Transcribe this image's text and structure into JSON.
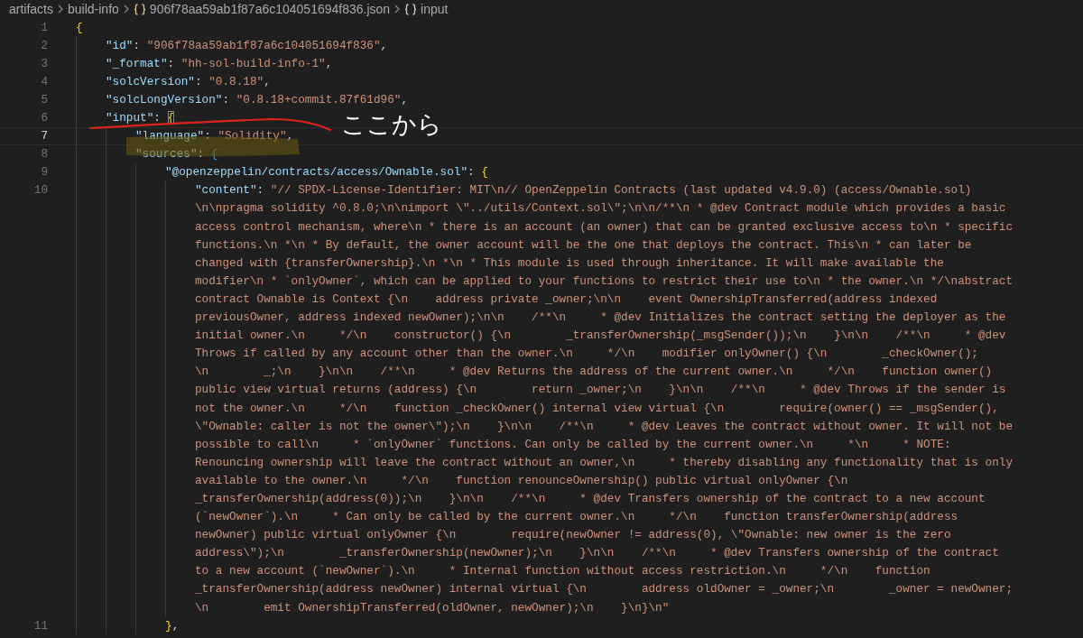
{
  "breadcrumb": [
    {
      "label": "artifacts",
      "kind": "folder"
    },
    {
      "label": "build-info",
      "kind": "folder"
    },
    {
      "label": "906f78aa59ab1f87a6c104051694f836.json",
      "kind": "json"
    },
    {
      "label": "input",
      "kind": "object"
    }
  ],
  "lines": [
    {
      "number": "1",
      "current": false,
      "tokens": [
        {
          "kind": "brace",
          "text": "{"
        }
      ],
      "children": [
        {
          "number": "2",
          "current": false,
          "tokens": [
            {
              "kind": "key",
              "text": "\"id\""
            },
            {
              "kind": "punct",
              "text": ": "
            },
            {
              "kind": "string",
              "text": "\"906f78aa59ab1f87a6c104051694f836\""
            },
            {
              "kind": "punct",
              "text": ","
            }
          ]
        },
        {
          "number": "3",
          "current": false,
          "tokens": [
            {
              "kind": "key",
              "text": "\"_format\""
            },
            {
              "kind": "punct",
              "text": ": "
            },
            {
              "kind": "string",
              "text": "\"hh-sol-build-info-1\""
            },
            {
              "kind": "punct",
              "text": ","
            }
          ]
        },
        {
          "number": "4",
          "current": false,
          "tokens": [
            {
              "kind": "key",
              "text": "\"solcVersion\""
            },
            {
              "kind": "punct",
              "text": ": "
            },
            {
              "kind": "string",
              "text": "\"0.8.18\""
            },
            {
              "kind": "punct",
              "text": ","
            }
          ]
        },
        {
          "number": "5",
          "current": false,
          "tokens": [
            {
              "kind": "key",
              "text": "\"solcLongVersion\""
            },
            {
              "kind": "punct",
              "text": ": "
            },
            {
              "kind": "string",
              "text": "\"0.8.18+commit.87f61d96\""
            },
            {
              "kind": "punct",
              "text": ","
            }
          ]
        },
        {
          "number": "6",
          "current": false,
          "tokens": [
            {
              "kind": "key",
              "text": "\"input\""
            },
            {
              "kind": "punct",
              "text": ": "
            },
            {
              "kind": "matched",
              "text": "{"
            }
          ],
          "children": [
            {
              "number": "7",
              "current": true,
              "tokens": [
                {
                  "kind": "key",
                  "text": "\"language\""
                },
                {
                  "kind": "punct",
                  "text": ": "
                },
                {
                  "kind": "string",
                  "text": "\"Solidity\""
                },
                {
                  "kind": "punct",
                  "text": ","
                }
              ]
            },
            {
              "number": "8",
              "current": false,
              "tokens": [
                {
                  "kind": "key",
                  "text": "\"sources\""
                },
                {
                  "kind": "punct",
                  "text": ": "
                },
                {
                  "kind": "innerbrace",
                  "text": "{"
                }
              ],
              "children": [
                {
                  "number": "9",
                  "current": false,
                  "tokens": [
                    {
                      "kind": "key",
                      "text": "\"@openzeppelin/contracts/access/Ownable.sol\""
                    },
                    {
                      "kind": "punct",
                      "text": ": "
                    },
                    {
                      "kind": "brace",
                      "text": "{"
                    }
                  ],
                  "children": [
                    {
                      "number": "10",
                      "current": false,
                      "tokens": [
                        {
                          "kind": "key",
                          "text": "\"content\""
                        },
                        {
                          "kind": "punct",
                          "text": ": "
                        },
                        {
                          "kind": "string",
                          "text": "\"// SPDX-License-Identifier: MIT\\n// OpenZeppelin Contracts (last updated v4.9.0) (access/Ownable.sol)"
                        }
                      ],
                      "wrap": [
                        "\\n\\npragma solidity ^0.8.0;\\n\\nimport \\\"../utils/Context.sol\\\";\\n\\n/**\\n * @dev Contract module which provides a basic",
                        "access control mechanism, where\\n * there is an account (an owner) that can be granted exclusive access to\\n * specific",
                        "functions.\\n *\\n * By default, the owner account will be the one that deploys the contract. This\\n * can later be",
                        "changed with {transferOwnership}.\\n *\\n * This module is used through inheritance. It will make available the",
                        "modifier\\n * `onlyOwner`, which can be applied to your functions to restrict their use to\\n * the owner.\\n */\\nabstract",
                        "contract Ownable is Context {\\n    address private _owner;\\n\\n    event OwnershipTransferred(address indexed",
                        "previousOwner, address indexed newOwner);\\n\\n    /**\\n     * @dev Initializes the contract setting the deployer as the",
                        "initial owner.\\n     */\\n    constructor() {\\n        _transferOwnership(_msgSender());\\n    }\\n\\n    /**\\n     * @dev",
                        "Throws if called by any account other than the owner.\\n     */\\n    modifier onlyOwner() {\\n        _checkOwner();",
                        "\\n        _;\\n    }\\n\\n    /**\\n     * @dev Returns the address of the current owner.\\n     */\\n    function owner()",
                        "public view virtual returns (address) {\\n        return _owner;\\n    }\\n\\n    /**\\n     * @dev Throws if the sender is",
                        "not the owner.\\n     */\\n    function _checkOwner() internal view virtual {\\n        require(owner() == _msgSender(),",
                        "\\\"Ownable: caller is not the owner\\\");\\n    }\\n\\n    /**\\n     * @dev Leaves the contract without owner. It will not be",
                        "possible to call\\n     * `onlyOwner` functions. Can only be called by the current owner.\\n     *\\n     * NOTE:",
                        "Renouncing ownership will leave the contract without an owner,\\n     * thereby disabling any functionality that is only",
                        "available to the owner.\\n     */\\n    function renounceOwnership() public virtual onlyOwner {\\n",
                        "_transferOwnership(address(0));\\n    }\\n\\n    /**\\n     * @dev Transfers ownership of the contract to a new account",
                        "(`newOwner`).\\n     * Can only be called by the current owner.\\n     */\\n    function transferOwnership(address",
                        "newOwner) public virtual onlyOwner {\\n        require(newOwner != address(0), \\\"Ownable: new owner is the zero",
                        "address\\\");\\n        _transferOwnership(newOwner);\\n    }\\n\\n    /**\\n     * @dev Transfers ownership of the contract",
                        "to a new account (`newOwner`).\\n     * Internal function without access restriction.\\n     */\\n    function",
                        "_transferOwnership(address newOwner) internal virtual {\\n        address oldOwner = _owner;\\n        _owner = newOwner;",
                        "\\n        emit OwnershipTransferred(oldOwner, newOwner);\\n    }\\n}\\n\""
                      ]
                    }
                  ]
                },
                {
                  "number": "11",
                  "current": false,
                  "tokens": [
                    {
                      "kind": "brace",
                      "text": "}"
                    },
                    {
                      "kind": "punct",
                      "text": ","
                    }
                  ]
                }
              ]
            }
          ]
        }
      ]
    }
  ],
  "annotation": {
    "text": "ここから"
  }
}
